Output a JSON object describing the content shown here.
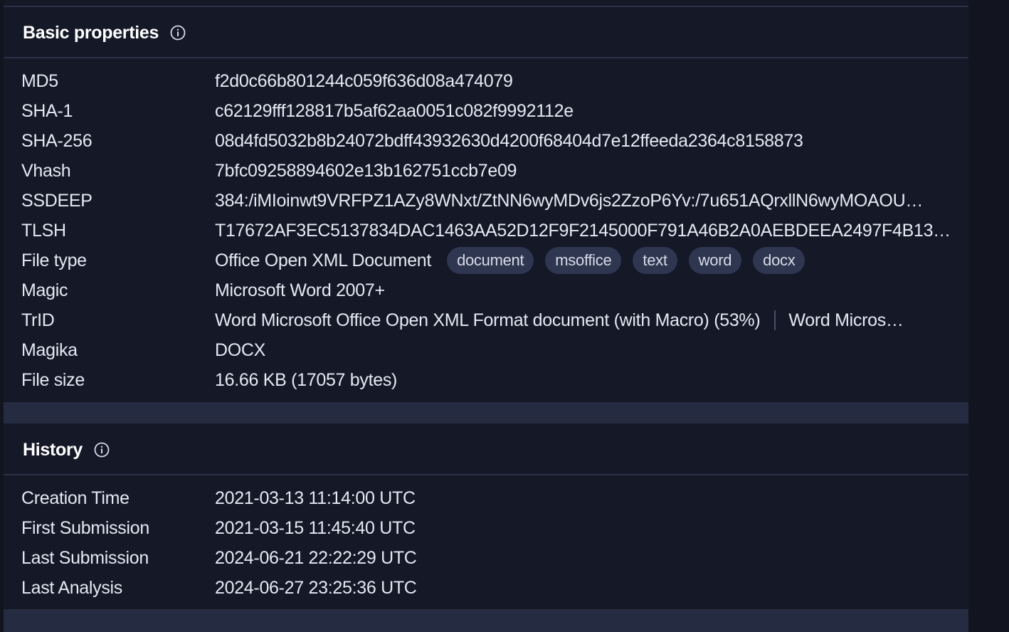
{
  "basic": {
    "title": "Basic properties",
    "rows": {
      "md5": {
        "label": "MD5",
        "value": "f2d0c66b801244c059f636d08a474079"
      },
      "sha1": {
        "label": "SHA-1",
        "value": "c62129fff128817b5af62aa0051c082f9992112e"
      },
      "sha256": {
        "label": "SHA-256",
        "value": "08d4fd5032b8b24072bdff43932630d4200f68404d7e12ffeeda2364c8158873"
      },
      "vhash": {
        "label": "Vhash",
        "value": "7bfc09258894602e13b162751ccb7e09"
      },
      "ssdeep": {
        "label": "SSDEEP",
        "value": "384:/iMIoinwt9VRFPZ1AZy8WNxt/ZtNN6wyMDv6js2ZzoP6Yv:/7u651AQrxllN6wyMOAOU…"
      },
      "tlsh": {
        "label": "TLSH",
        "value": "T17672AF3EC5137834DAC1463AA52D12F9F2145000F791A46B2A0AEBDEEA2497F4B13…"
      },
      "filetype": {
        "label": "File type",
        "value": "Office Open XML Document",
        "tags": [
          "document",
          "msoffice",
          "text",
          "word",
          "docx"
        ]
      },
      "magic": {
        "label": "Magic",
        "value": "Microsoft Word 2007+"
      },
      "trid": {
        "label": "TrID",
        "value": "Word Microsoft Office Open XML Format document (with Macro) (53%)",
        "value2": "Word Micros…"
      },
      "magika": {
        "label": "Magika",
        "value": "DOCX"
      },
      "filesize": {
        "label": "File size",
        "value": "16.66 KB (17057 bytes)"
      }
    }
  },
  "history": {
    "title": "History",
    "rows": {
      "creation": {
        "label": "Creation Time",
        "value": "2021-03-13 11:14:00 UTC"
      },
      "first": {
        "label": "First Submission",
        "value": "2021-03-15 11:45:40 UTC"
      },
      "last": {
        "label": "Last Submission",
        "value": "2024-06-21 22:22:29 UTC"
      },
      "analysis": {
        "label": "Last Analysis",
        "value": "2024-06-27 23:25:36 UTC"
      }
    }
  },
  "icons": {
    "info": "info-circle-icon"
  },
  "colors": {
    "background": "#151827",
    "band": "#252b40",
    "tag": "#2f3650",
    "text": "#e6e8f2"
  }
}
